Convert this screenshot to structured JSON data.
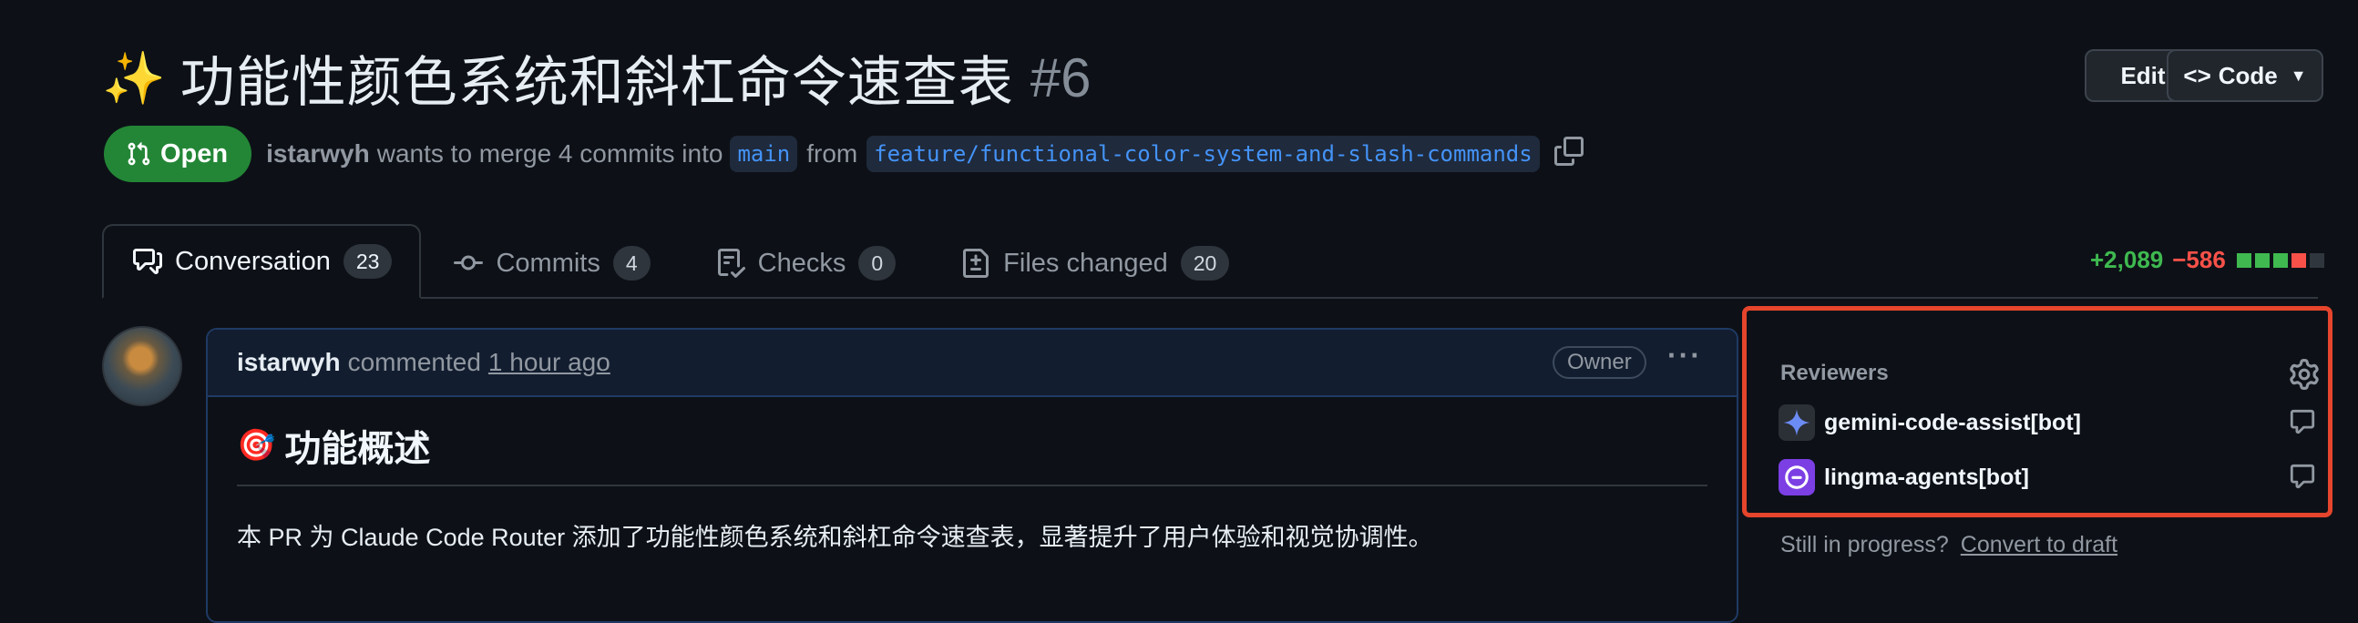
{
  "pr": {
    "title": "功能性颜色系统和斜杠命令速查表",
    "number": "#6",
    "title_emoji": "✨"
  },
  "actions": {
    "edit_label": "Edit",
    "code_label": "Code"
  },
  "status": {
    "badge": "Open",
    "author": "istarwyh",
    "merge_text": "wants to merge 4 commits into",
    "base_branch": "main",
    "from_text": "from",
    "head_branch": "feature/functional-color-system-and-slash-commands"
  },
  "tabs": [
    {
      "label": "Conversation",
      "count": "23"
    },
    {
      "label": "Commits",
      "count": "4"
    },
    {
      "label": "Checks",
      "count": "0"
    },
    {
      "label": "Files changed",
      "count": "20"
    }
  ],
  "diffstat": {
    "additions": "+2,089",
    "deletions": "−586"
  },
  "comment": {
    "author": "istarwyh",
    "verb": "commented",
    "time": "1 hour ago",
    "role": "Owner",
    "heading": "功能概述",
    "heading_emoji": "🎯",
    "body": "本 PR 为 Claude Code Router 添加了功能性颜色系统和斜杠命令速查表，显著提升了用户体验和视觉协调性。"
  },
  "sidebar": {
    "reviewers_title": "Reviewers",
    "reviewers": [
      {
        "name": "gemini-code-assist[bot]",
        "icon": "gemini-sparkle-icon"
      },
      {
        "name": "lingma-agents[bot]",
        "icon": "lingma-icon"
      }
    ],
    "progress_text": "Still in progress?",
    "draft_link": "Convert to draft"
  },
  "colors": {
    "open": "#238636",
    "additions": "#3fb950",
    "deletions": "#f85149",
    "highlight": "#e5452c"
  }
}
